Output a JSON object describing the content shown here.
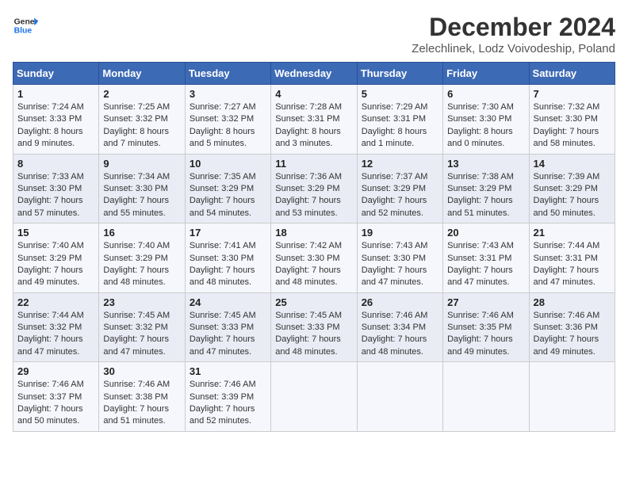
{
  "header": {
    "logo_line1": "General",
    "logo_line2": "Blue",
    "title": "December 2024",
    "subtitle": "Zelechlinek, Lodz Voivodeship, Poland"
  },
  "weekdays": [
    "Sunday",
    "Monday",
    "Tuesday",
    "Wednesday",
    "Thursday",
    "Friday",
    "Saturday"
  ],
  "weeks": [
    [
      {
        "day": "1",
        "sunrise": "7:24 AM",
        "sunset": "3:33 PM",
        "daylight": "8 hours and 9 minutes."
      },
      {
        "day": "2",
        "sunrise": "7:25 AM",
        "sunset": "3:32 PM",
        "daylight": "8 hours and 7 minutes."
      },
      {
        "day": "3",
        "sunrise": "7:27 AM",
        "sunset": "3:32 PM",
        "daylight": "8 hours and 5 minutes."
      },
      {
        "day": "4",
        "sunrise": "7:28 AM",
        "sunset": "3:31 PM",
        "daylight": "8 hours and 3 minutes."
      },
      {
        "day": "5",
        "sunrise": "7:29 AM",
        "sunset": "3:31 PM",
        "daylight": "8 hours and 1 minute."
      },
      {
        "day": "6",
        "sunrise": "7:30 AM",
        "sunset": "3:30 PM",
        "daylight": "8 hours and 0 minutes."
      },
      {
        "day": "7",
        "sunrise": "7:32 AM",
        "sunset": "3:30 PM",
        "daylight": "7 hours and 58 minutes."
      }
    ],
    [
      {
        "day": "8",
        "sunrise": "7:33 AM",
        "sunset": "3:30 PM",
        "daylight": "7 hours and 57 minutes."
      },
      {
        "day": "9",
        "sunrise": "7:34 AM",
        "sunset": "3:30 PM",
        "daylight": "7 hours and 55 minutes."
      },
      {
        "day": "10",
        "sunrise": "7:35 AM",
        "sunset": "3:29 PM",
        "daylight": "7 hours and 54 minutes."
      },
      {
        "day": "11",
        "sunrise": "7:36 AM",
        "sunset": "3:29 PM",
        "daylight": "7 hours and 53 minutes."
      },
      {
        "day": "12",
        "sunrise": "7:37 AM",
        "sunset": "3:29 PM",
        "daylight": "7 hours and 52 minutes."
      },
      {
        "day": "13",
        "sunrise": "7:38 AM",
        "sunset": "3:29 PM",
        "daylight": "7 hours and 51 minutes."
      },
      {
        "day": "14",
        "sunrise": "7:39 AM",
        "sunset": "3:29 PM",
        "daylight": "7 hours and 50 minutes."
      }
    ],
    [
      {
        "day": "15",
        "sunrise": "7:40 AM",
        "sunset": "3:29 PM",
        "daylight": "7 hours and 49 minutes."
      },
      {
        "day": "16",
        "sunrise": "7:40 AM",
        "sunset": "3:29 PM",
        "daylight": "7 hours and 48 minutes."
      },
      {
        "day": "17",
        "sunrise": "7:41 AM",
        "sunset": "3:30 PM",
        "daylight": "7 hours and 48 minutes."
      },
      {
        "day": "18",
        "sunrise": "7:42 AM",
        "sunset": "3:30 PM",
        "daylight": "7 hours and 48 minutes."
      },
      {
        "day": "19",
        "sunrise": "7:43 AM",
        "sunset": "3:30 PM",
        "daylight": "7 hours and 47 minutes."
      },
      {
        "day": "20",
        "sunrise": "7:43 AM",
        "sunset": "3:31 PM",
        "daylight": "7 hours and 47 minutes."
      },
      {
        "day": "21",
        "sunrise": "7:44 AM",
        "sunset": "3:31 PM",
        "daylight": "7 hours and 47 minutes."
      }
    ],
    [
      {
        "day": "22",
        "sunrise": "7:44 AM",
        "sunset": "3:32 PM",
        "daylight": "7 hours and 47 minutes."
      },
      {
        "day": "23",
        "sunrise": "7:45 AM",
        "sunset": "3:32 PM",
        "daylight": "7 hours and 47 minutes."
      },
      {
        "day": "24",
        "sunrise": "7:45 AM",
        "sunset": "3:33 PM",
        "daylight": "7 hours and 47 minutes."
      },
      {
        "day": "25",
        "sunrise": "7:45 AM",
        "sunset": "3:33 PM",
        "daylight": "7 hours and 48 minutes."
      },
      {
        "day": "26",
        "sunrise": "7:46 AM",
        "sunset": "3:34 PM",
        "daylight": "7 hours and 48 minutes."
      },
      {
        "day": "27",
        "sunrise": "7:46 AM",
        "sunset": "3:35 PM",
        "daylight": "7 hours and 49 minutes."
      },
      {
        "day": "28",
        "sunrise": "7:46 AM",
        "sunset": "3:36 PM",
        "daylight": "7 hours and 49 minutes."
      }
    ],
    [
      {
        "day": "29",
        "sunrise": "7:46 AM",
        "sunset": "3:37 PM",
        "daylight": "7 hours and 50 minutes."
      },
      {
        "day": "30",
        "sunrise": "7:46 AM",
        "sunset": "3:38 PM",
        "daylight": "7 hours and 51 minutes."
      },
      {
        "day": "31",
        "sunrise": "7:46 AM",
        "sunset": "3:39 PM",
        "daylight": "7 hours and 52 minutes."
      },
      null,
      null,
      null,
      null
    ]
  ]
}
